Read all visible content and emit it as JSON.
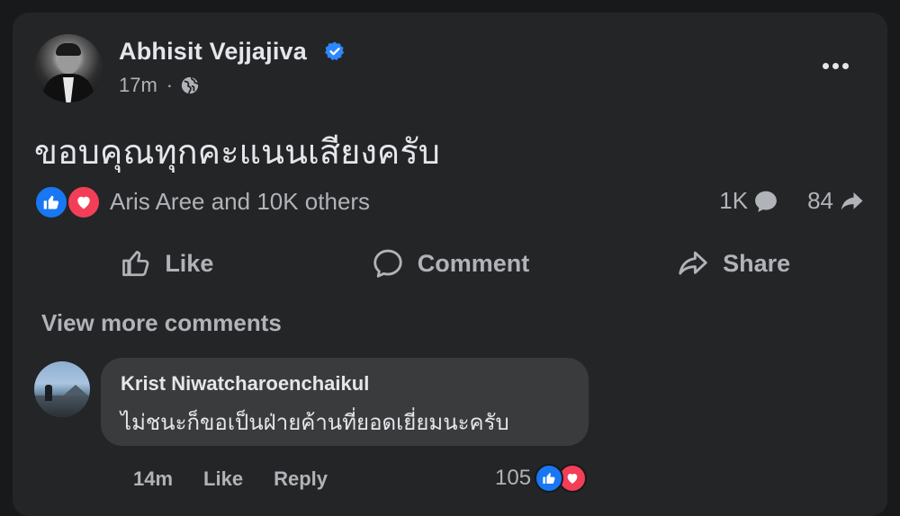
{
  "post": {
    "author_name": "Abhisit Vejjajiva",
    "verified_icon": "verified-badge-icon",
    "time": "17m",
    "separator": "·",
    "audience_icon": "globe-icon",
    "text": "ขอบคุณทุกคะแนนเสียงครับ",
    "reactions_summary": "Aris Aree and 10K others",
    "comment_count": "1K",
    "share_count": "84"
  },
  "actions": {
    "like": "Like",
    "comment": "Comment",
    "share": "Share"
  },
  "comments": {
    "view_more": "View more comments",
    "items": [
      {
        "author": "Krist Niwatcharoenchaikul",
        "text": "ไม่ชนะก็ขอเป็นฝ่ายค้านที่ยอดเยี่ยมนะครับ",
        "time": "14m",
        "like_label": "Like",
        "reply_label": "Reply",
        "reaction_count": "105"
      }
    ]
  },
  "colors": {
    "background": "#18191a",
    "card": "#242526",
    "bubble": "#3a3b3c",
    "like_blue": "#1877f2",
    "love_red": "#f33e58",
    "verified_blue": "#2d88ff",
    "primary_text": "#e4e6eb",
    "secondary_text": "#b0b3b8"
  }
}
